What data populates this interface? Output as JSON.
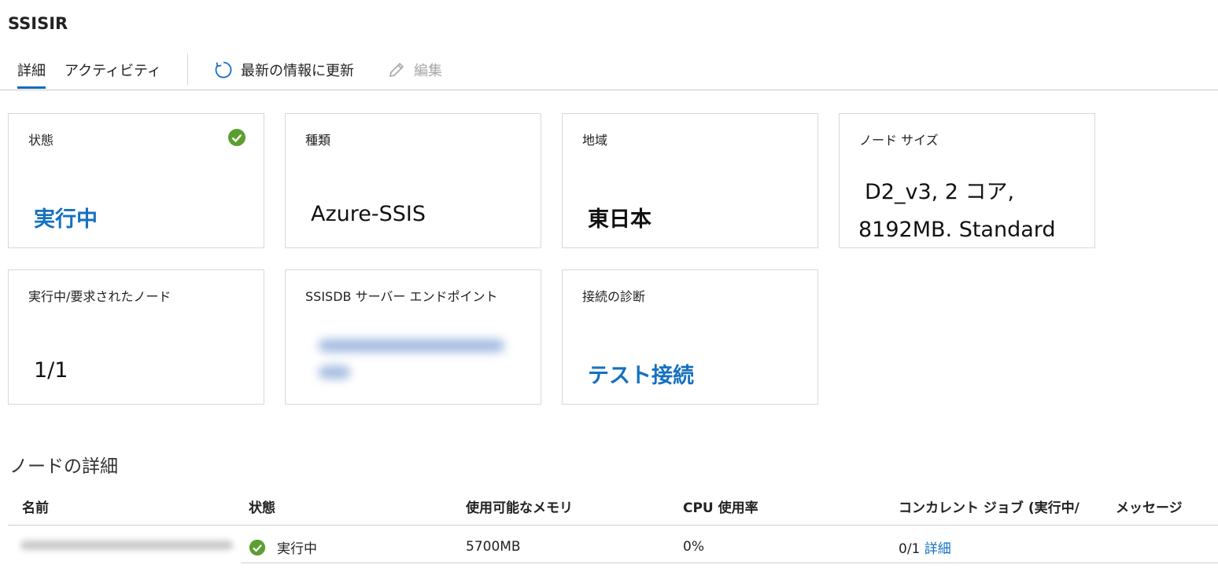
{
  "header": {
    "title": "SSISIR"
  },
  "toolbar": {
    "tab_details": "詳細",
    "tab_activity": "アクティビティ",
    "refresh_label": "最新の情報に更新",
    "edit_label": "編集"
  },
  "tiles": {
    "status": {
      "label": "状態",
      "value": "実行中"
    },
    "type": {
      "label": "種類",
      "value": "Azure-SSIS"
    },
    "region": {
      "label": "地域",
      "value": "東日本"
    },
    "node_size": {
      "label": "ノード サイズ",
      "value_line1": "D2_v3, 2 コア,",
      "value_line2": "8192MB. Standard"
    },
    "nodes": {
      "label": "実行中/要求されたノード",
      "value": "1/1"
    },
    "endpoint": {
      "label": "SSISDB サーバー エンドポイント"
    },
    "diagnostics": {
      "label": "接続の診断",
      "value": "テスト接続"
    }
  },
  "node_details": {
    "title": "ノードの詳細",
    "columns": [
      "名前",
      "状態",
      "使用可能なメモリ",
      "CPU 使用率",
      "コンカレント ジョブ (実行中/",
      "メッセージ"
    ],
    "rows": [
      {
        "status": "実行中",
        "memory": "5700MB",
        "cpu": "0%",
        "jobs": "0/1",
        "jobs_link": "詳細"
      }
    ]
  },
  "colors": {
    "accent": "#0f6cbd",
    "link": "#1570c0",
    "success": "#5c9e31"
  },
  "icons": [
    "refresh-icon",
    "edit-icon",
    "check-circle-icon"
  ]
}
